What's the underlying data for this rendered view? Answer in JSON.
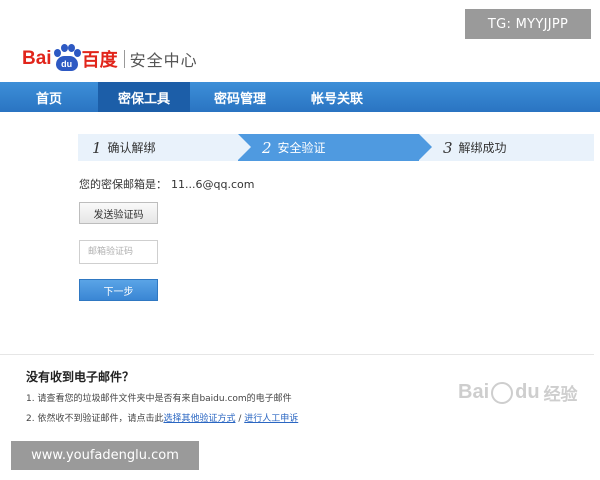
{
  "watermarks": {
    "tg": "TG: MYYJJPP",
    "url": "www.youfadenglu.com",
    "baidu_jingyan": {
      "latin_1": "Bai",
      "latin_2": "du",
      "cn": "经验"
    }
  },
  "logo": {
    "bai": "Bai",
    "du": "du",
    "cn": "百度",
    "subtitle": "安全中心",
    "icon": "baidu-paw-icon"
  },
  "nav": {
    "items": [
      {
        "label": "首页",
        "active": false
      },
      {
        "label": "密保工具",
        "active": true
      },
      {
        "label": "密码管理",
        "active": false
      },
      {
        "label": "帐号关联",
        "active": false
      }
    ]
  },
  "steps": [
    {
      "num": "1",
      "label": "确认解绑"
    },
    {
      "num": "2",
      "label": "安全验证"
    },
    {
      "num": "3",
      "label": "解绑成功"
    }
  ],
  "form": {
    "email_label": "您的密保邮箱是：",
    "email_value": "11...6@qq.com",
    "send_button": "发送验证码",
    "code_placeholder": "邮箱验证码",
    "next_button": "下一步"
  },
  "help": {
    "title": "没有收到电子邮件？",
    "line1": "1. 请查看您的垃圾邮件文件夹中是否有来自baidu.com的电子邮件",
    "line2_prefix": "2. 依然收不到验证邮件，请点击此",
    "line2_link1": "选择其他验证方式",
    "line2_sep": " / ",
    "line2_link2": "进行人工申诉"
  },
  "colors": {
    "nav_bg": "#2a74c2",
    "nav_active": "#1c5ea8",
    "step_active": "#4f9ae0",
    "step_inactive": "#e9f2fb",
    "logo_red": "#e1251b",
    "logo_blue": "#2d59c3",
    "link": "#2a66c2"
  }
}
